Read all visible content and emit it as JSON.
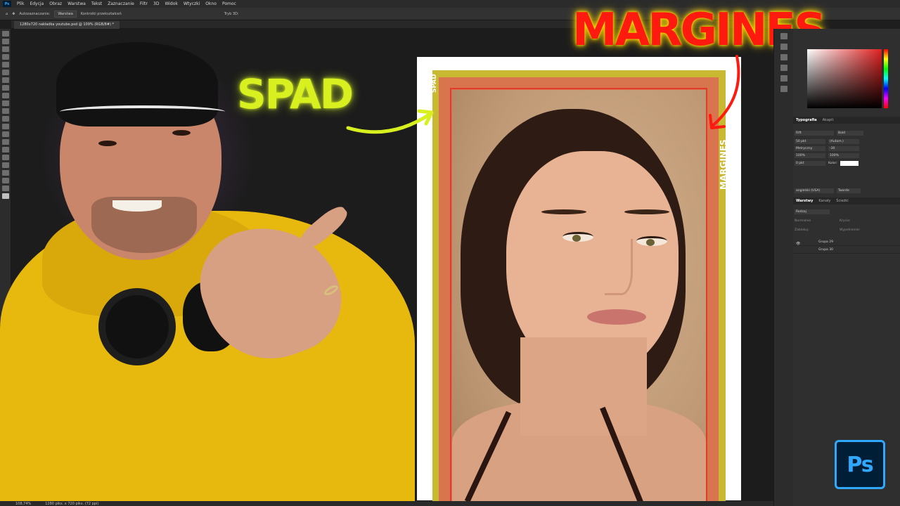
{
  "menubar": {
    "items": [
      "Plik",
      "Edycja",
      "Obraz",
      "Warstwa",
      "Tekst",
      "Zaznaczanie",
      "Filtr",
      "3D",
      "Widok",
      "Wtyczki",
      "Okno",
      "Pomoc"
    ]
  },
  "options": {
    "auto_select_label": "Autozaznaczanie:",
    "auto_select_value": "Warstwa",
    "transform_label": "Kontrolki przekształceń",
    "mode_3d_label": "Tryb 3D:"
  },
  "document": {
    "tab_title": "1280x720 nakładka youtube.psd @ 109% (RGB/8#) *",
    "bleed_text": "SPAD",
    "margin_text": "MARGINES"
  },
  "annotations": {
    "spad": "SPAD",
    "margines": "MARGINES"
  },
  "status": {
    "zoom": "108,74%",
    "dimensions": "1280 piks. x 720 piks. (72 ppi)"
  },
  "typography_panel": {
    "tabs": [
      "Typografia",
      "Akapit"
    ],
    "font_family": "Rift",
    "font_style": "Bold",
    "font_size": "50 pkt",
    "leading": "(Autom.)",
    "kerning": "Metryczny",
    "tracking": "-30",
    "vertical_scale": "100%",
    "horizontal_scale": "100%",
    "baseline": "0 pkt",
    "color_label": "Kolor:",
    "language": "angielski (USA)",
    "antialias": "Twarde"
  },
  "layers_panel": {
    "tabs": [
      "Warstwy",
      "Kanały",
      "Ścieżki"
    ],
    "filter": "Rodzaj",
    "blend_mode": "Normalnie",
    "opacity_label": "Krycie:",
    "lock_label": "Zablokuj:",
    "fill_label": "Wypełnienie:",
    "layers": [
      "Grupa 29",
      "Grupa 30"
    ]
  },
  "app_logo": "Ps",
  "colors": {
    "bleed": "#c8b832",
    "margin": "#e03b2c",
    "spad_text": "#d8f020",
    "margines_text": "#ff1a10",
    "ps_blue": "#31a8ff"
  }
}
